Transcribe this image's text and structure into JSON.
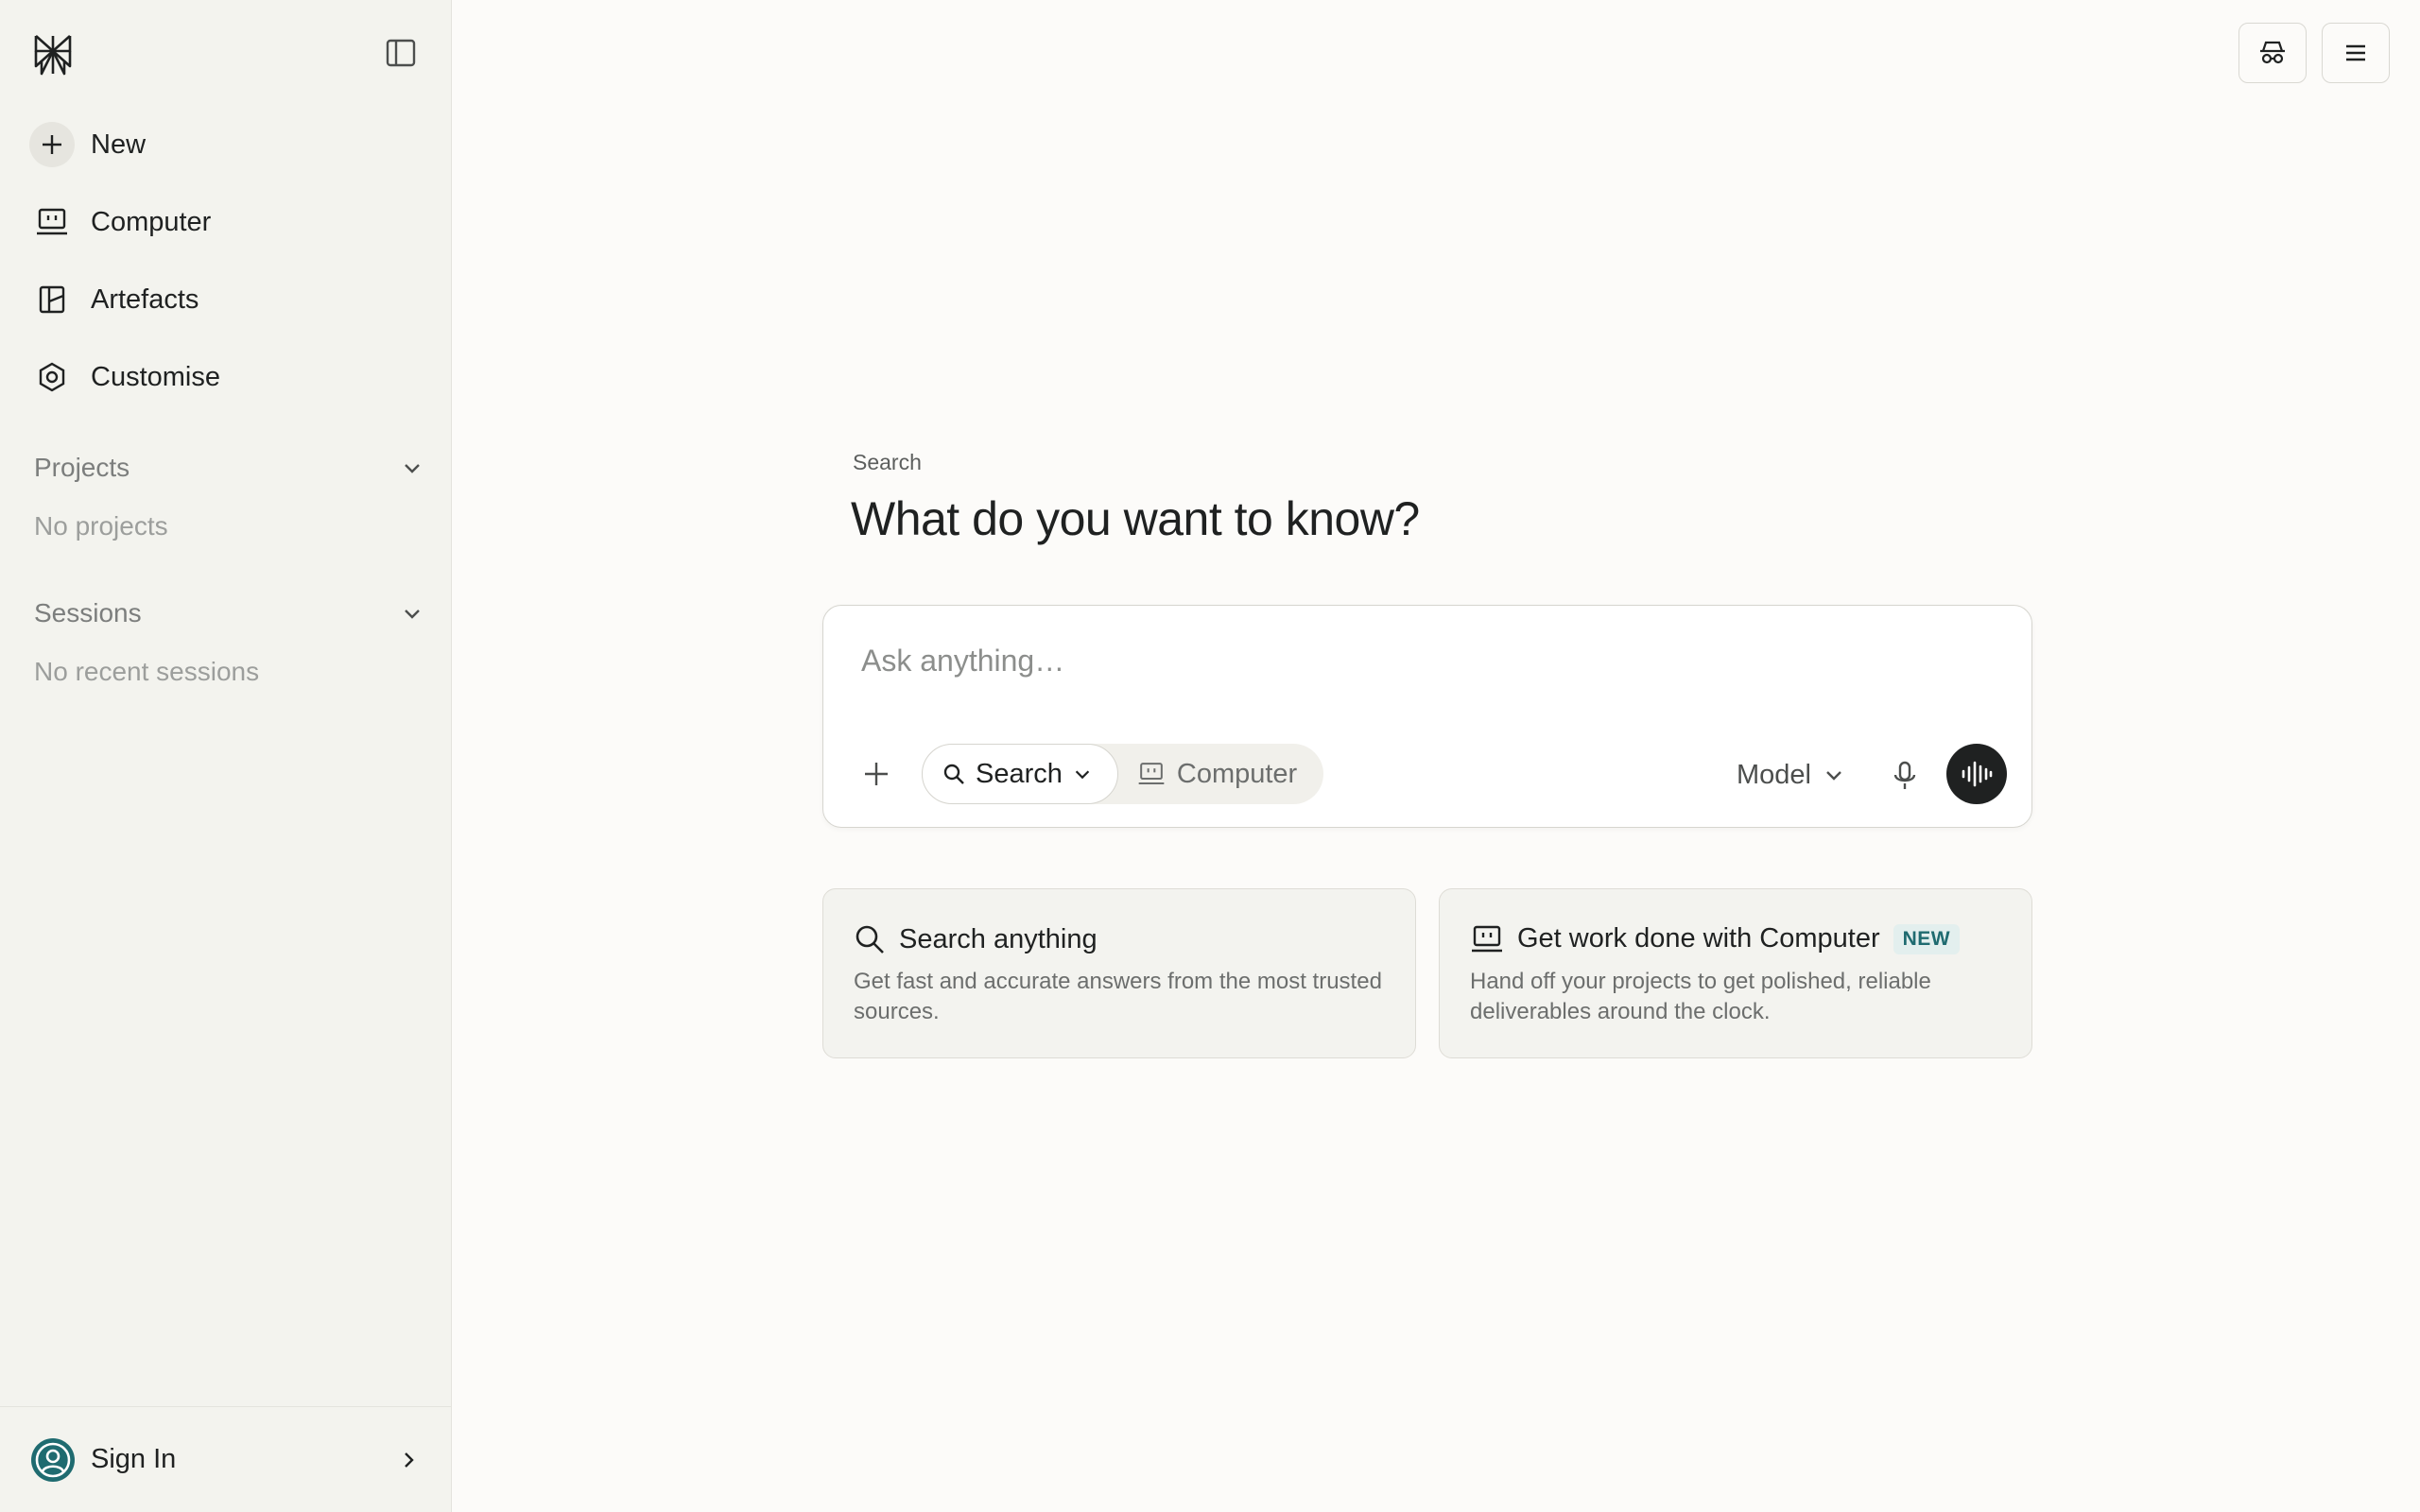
{
  "sidebar": {
    "nav": [
      {
        "label": "New",
        "icon": "plus-icon"
      },
      {
        "label": "Computer",
        "icon": "computer-icon"
      },
      {
        "label": "Artefacts",
        "icon": "artefacts-icon"
      },
      {
        "label": "Customise",
        "icon": "customise-icon"
      }
    ],
    "projects": {
      "label": "Projects",
      "empty": "No projects"
    },
    "sessions": {
      "label": "Sessions",
      "empty": "No recent sessions"
    },
    "footer": {
      "label": "Sign In"
    }
  },
  "main": {
    "eyebrow": "Search",
    "headline": "What do you want to know?",
    "composer": {
      "placeholder": "Ask anything…",
      "mode_search": "Search",
      "mode_computer": "Computer",
      "model": "Model"
    },
    "cards": [
      {
        "title": "Search anything",
        "desc": "Get fast and accurate answers from the most trusted sources.",
        "icon": "search-icon"
      },
      {
        "title": "Get work done with Computer",
        "badge": "NEW",
        "desc": "Hand off your projects to get polished, reliable deliverables around the clock.",
        "icon": "computer-icon"
      }
    ]
  },
  "colors": {
    "sidebar_bg": "#f3f3ee",
    "page_bg": "#fcfbf9",
    "accent": "#1f6b70",
    "text": "#1f2121"
  }
}
